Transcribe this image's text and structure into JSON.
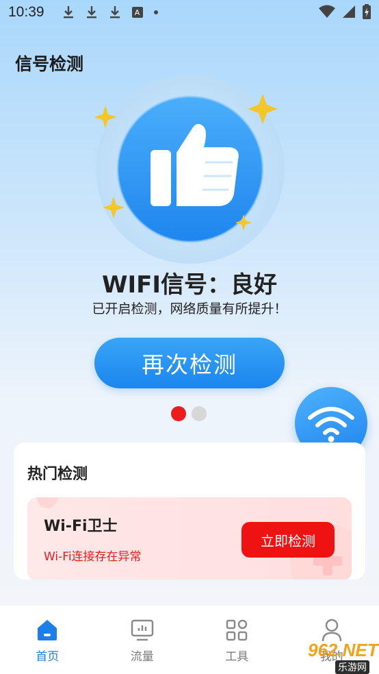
{
  "status_bar": {
    "time": "10:39",
    "left_icons": [
      "download-icon",
      "download-icon",
      "download-icon",
      "a-icon",
      "dot-icon"
    ],
    "right_icons": [
      "wifi-signal-icon",
      "cell-signal-icon",
      "battery-charging-icon"
    ]
  },
  "page": {
    "title": "信号检测"
  },
  "hero": {
    "icon": "thumbs-up-icon",
    "status_title": "WIFI信号：良好",
    "status_subtitle": "已开启检测，网络质量有所提升！",
    "retest_label": "再次检测"
  },
  "pager": {
    "count": 2,
    "active_index": 0,
    "active_color": "#ee1c1c"
  },
  "fab": {
    "icon": "wifi-icon"
  },
  "hot_section": {
    "title": "热门检测",
    "items": [
      {
        "title": "Wi-Fi卫士",
        "description": "Wi-Fi连接存在异常",
        "action_label": "立即检测"
      }
    ]
  },
  "bottom_nav": {
    "items": [
      {
        "label": "首页",
        "icon": "home-icon",
        "active": true
      },
      {
        "label": "流量",
        "icon": "traffic-chart-icon",
        "active": false
      },
      {
        "label": "工具",
        "icon": "tools-grid-icon",
        "active": false
      },
      {
        "label": "我的",
        "icon": "user-icon",
        "active": false
      }
    ]
  },
  "watermark": {
    "main": "962.NET",
    "sub": "乐游网"
  },
  "colors": {
    "accent_blue": "#1b86ee",
    "danger_red": "#ee1212",
    "nav_active": "#1a7fe8"
  }
}
